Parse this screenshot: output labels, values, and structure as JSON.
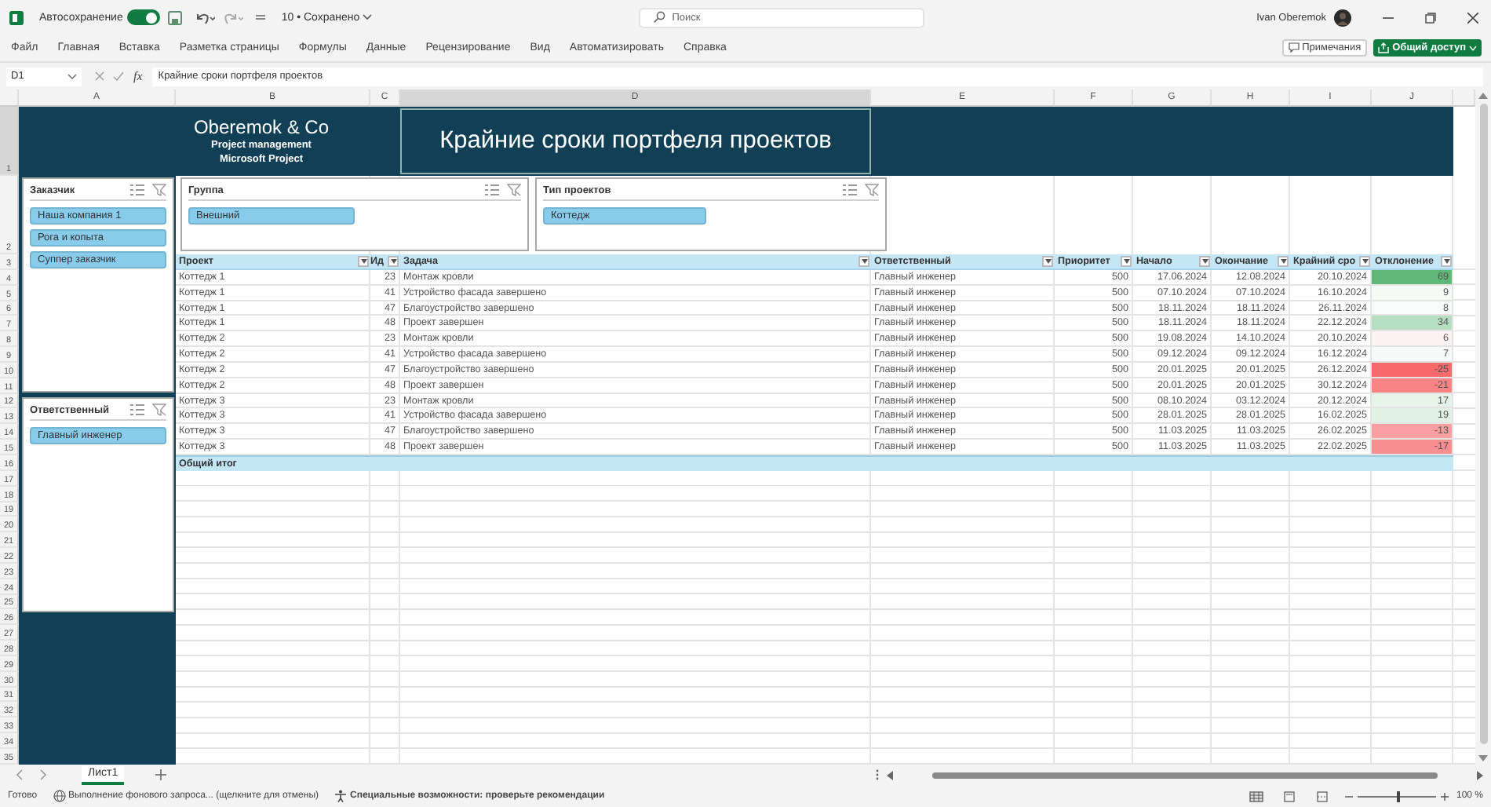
{
  "titlebar": {
    "autosave_label": "Автосохранение",
    "autosave_on": true,
    "document": "10 • Сохранено",
    "search_placeholder": "Поиск",
    "user": "Ivan Oberemok"
  },
  "ribbon_tabs": [
    "Файл",
    "Главная",
    "Вставка",
    "Разметка страницы",
    "Формулы",
    "Данные",
    "Рецензирование",
    "Вид",
    "Автоматизировать",
    "Справка"
  ],
  "comments_button": "Примечания",
  "share_button": "Общий доступ",
  "formula_bar": {
    "cell": "D1",
    "fx": "fx",
    "formula": "Крайние сроки портфеля проектов"
  },
  "column_letters": [
    "A",
    "B",
    "C",
    "D",
    "E",
    "F",
    "G",
    "H",
    "I",
    "J"
  ],
  "row_numbers": [
    "1",
    "2",
    "3",
    "4",
    "5",
    "6",
    "7",
    "8",
    "9",
    "10",
    "11",
    "12",
    "13",
    "14",
    "15",
    "16",
    "17",
    "18",
    "19",
    "20",
    "21",
    "22",
    "23",
    "24",
    "25",
    "26",
    "27",
    "28",
    "29",
    "30",
    "31",
    "32",
    "33",
    "34",
    "35"
  ],
  "banner": {
    "company": "Oberemok & Co",
    "line_2": "Project management",
    "line_3": "Microsoft Project",
    "title": "Крайние сроки портфеля проектов"
  },
  "slicers": [
    {
      "title": "Заказчик",
      "items": [
        {
          "label": "Наша компания 1",
          "selected": true
        },
        {
          "label": "Рога и копыта",
          "selected": true
        },
        {
          "label": "Суппер заказчик",
          "selected": true
        }
      ]
    },
    {
      "title": "Группа",
      "items": [
        {
          "label": "Внешний",
          "selected": true
        }
      ]
    },
    {
      "title": "Тип проектов",
      "items": [
        {
          "label": "Коттедж",
          "selected": true
        }
      ]
    },
    {
      "title": "Ответственный",
      "items": [
        {
          "label": "Главный инженер",
          "selected": true
        }
      ]
    }
  ],
  "table": {
    "columns": [
      "Проект",
      "Ид",
      "Задача",
      "Ответственный",
      "Приоритет",
      "Начало",
      "Окончание",
      "Крайний сро",
      "Отклонение"
    ],
    "rows": [
      {
        "cells": [
          "Коттедж 1",
          "23",
          "Монтаж кровли",
          "Главный инженер",
          "500",
          "17.06.2024",
          "12.08.2024",
          "20.10.2024",
          "69"
        ],
        "color": "#5eb877"
      },
      {
        "cells": [
          "Коттедж 1",
          "41",
          "Устройство фасада завершено",
          "Главный инженер",
          "500",
          "07.10.2024",
          "07.10.2024",
          "16.10.2024",
          "9"
        ],
        "color": "#f6faf7"
      },
      {
        "cells": [
          "Коттедж 1",
          "47",
          "Благоустройство завершено",
          "Главный инженер",
          "500",
          "18.11.2024",
          "18.11.2024",
          "26.11.2024",
          "8"
        ],
        "color": "#f9fbfa"
      },
      {
        "cells": [
          "Коттедж 1",
          "48",
          "Проект завершен",
          "Главный инженер",
          "500",
          "18.11.2024",
          "18.11.2024",
          "22.12.2024",
          "34"
        ],
        "color": "#b6dfc1"
      },
      {
        "cells": [
          "Коттедж 2",
          "23",
          "Монтаж кровли",
          "Главный инженер",
          "500",
          "19.08.2024",
          "14.10.2024",
          "20.10.2024",
          "6"
        ],
        "color": "#fcf2f3"
      },
      {
        "cells": [
          "Коттедж 2",
          "41",
          "Устройство фасада завершено",
          "Главный инженер",
          "500",
          "09.12.2024",
          "09.12.2024",
          "16.12.2024",
          "7"
        ],
        "color": "#f7faf8"
      },
      {
        "cells": [
          "Коттедж 2",
          "47",
          "Благоустройство завершено",
          "Главный инженер",
          "500",
          "20.01.2025",
          "20.01.2025",
          "26.12.2024",
          "-25"
        ],
        "color": "#f8696b"
      },
      {
        "cells": [
          "Коттедж 2",
          "48",
          "Проект завершен",
          "Главный инженер",
          "500",
          "20.01.2025",
          "20.01.2025",
          "30.12.2024",
          "-21"
        ],
        "color": "#f98385"
      },
      {
        "cells": [
          "Коттедж 3",
          "23",
          "Монтаж кровли",
          "Главный инженер",
          "500",
          "08.10.2024",
          "03.12.2024",
          "20.12.2024",
          "17"
        ],
        "color": "#e6f3e9"
      },
      {
        "cells": [
          "Коттедж 3",
          "41",
          "Устройство фасада завершено",
          "Главный инженер",
          "500",
          "28.01.2025",
          "28.01.2025",
          "16.02.2025",
          "19"
        ],
        "color": "#e2f1e6"
      },
      {
        "cells": [
          "Коттедж 3",
          "47",
          "Благоустройство завершено",
          "Главный инженер",
          "500",
          "11.03.2025",
          "11.03.2025",
          "26.02.2025",
          "-13"
        ],
        "color": "#fa9fa1"
      },
      {
        "cells": [
          "Коттедж 3",
          "48",
          "Проект завершен",
          "Главный инженер",
          "500",
          "11.03.2025",
          "11.03.2025",
          "22.02.2025",
          "-17"
        ],
        "color": "#f98e90"
      }
    ],
    "total_label": "Общий итог"
  },
  "sheet_tabs": [
    {
      "label": "Лист1",
      "selected": true
    }
  ],
  "status": {
    "ready": "Готово",
    "background_query": "Выполнение фонового запроса... (щелкните для отмены)",
    "accessibility": "Специальные возможности: проверьте рекомендации",
    "zoom_slider": {
      "level": 0.5
    },
    "zoom": "100 %"
  }
}
